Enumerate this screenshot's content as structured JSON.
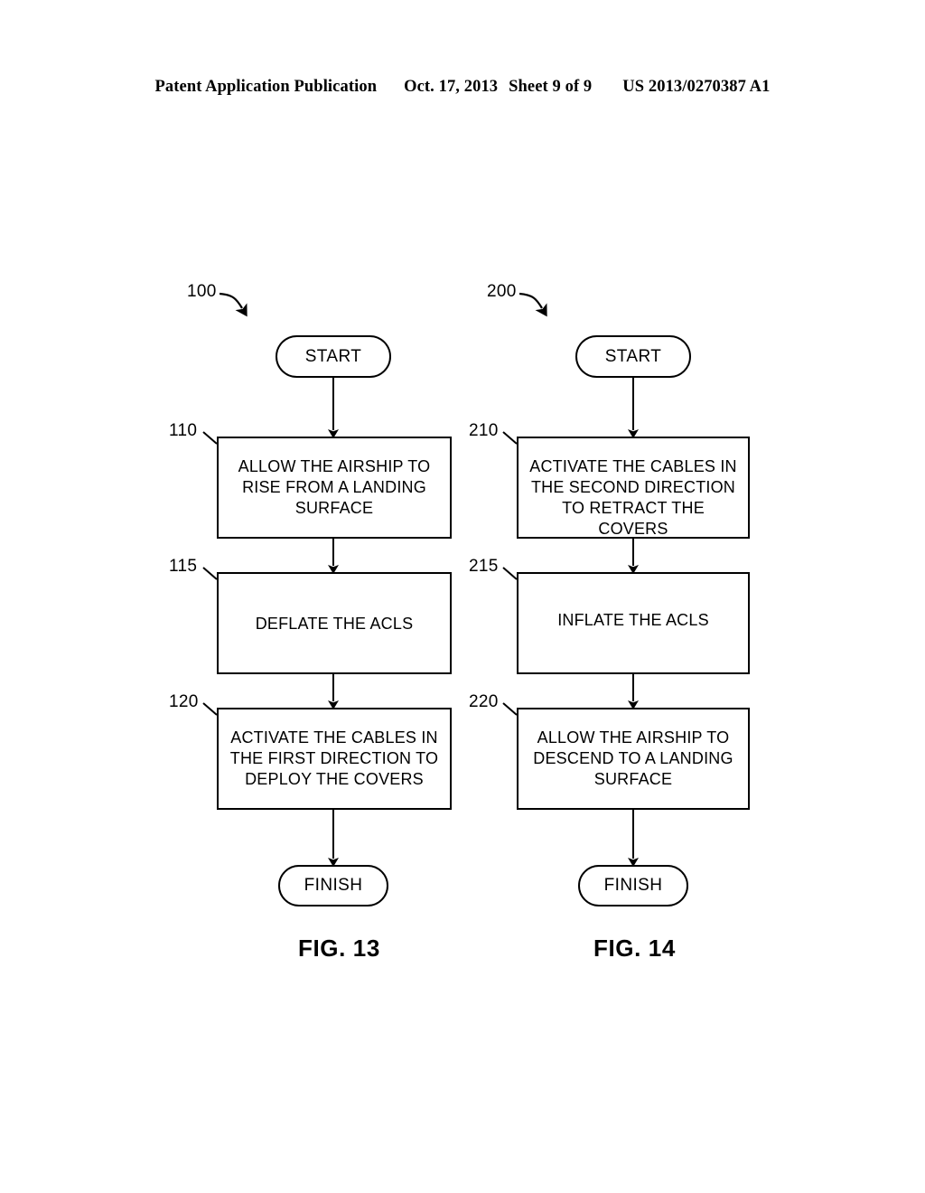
{
  "header": {
    "publication": "Patent Application Publication",
    "date": "Oct. 17, 2013",
    "sheet": "Sheet 9 of 9",
    "patent_number": "US 2013/0270387 A1"
  },
  "figures": [
    {
      "caption": "FIG. 13",
      "ref_label": "100",
      "start_label": "START",
      "finish_label": "FINISH",
      "steps": [
        {
          "ref": "110",
          "lines": [
            "ALLOW THE AIRSHIP TO",
            "RISE FROM A LANDING",
            "SURFACE"
          ]
        },
        {
          "ref": "115",
          "lines": [
            "DEFLATE THE ACLS"
          ]
        },
        {
          "ref": "120",
          "lines": [
            "ACTIVATE THE CABLES IN",
            "THE FIRST DIRECTION TO",
            "DEPLOY THE COVERS"
          ]
        }
      ]
    },
    {
      "caption": "FIG. 14",
      "ref_label": "200",
      "start_label": "START",
      "finish_label": "FINISH",
      "steps": [
        {
          "ref": "210",
          "lines": [
            "ACTIVATE THE CABLES IN",
            "THE SECOND DIRECTION",
            "TO RETRACT THE",
            "COVERS"
          ]
        },
        {
          "ref": "215",
          "lines": [
            "INFLATE THE ACLS"
          ]
        },
        {
          "ref": "220",
          "lines": [
            "ALLOW THE AIRSHIP TO",
            "DESCEND TO A LANDING",
            "SURFACE"
          ]
        }
      ]
    }
  ],
  "colors": {
    "ink": "#000000",
    "paper": "#ffffff"
  }
}
